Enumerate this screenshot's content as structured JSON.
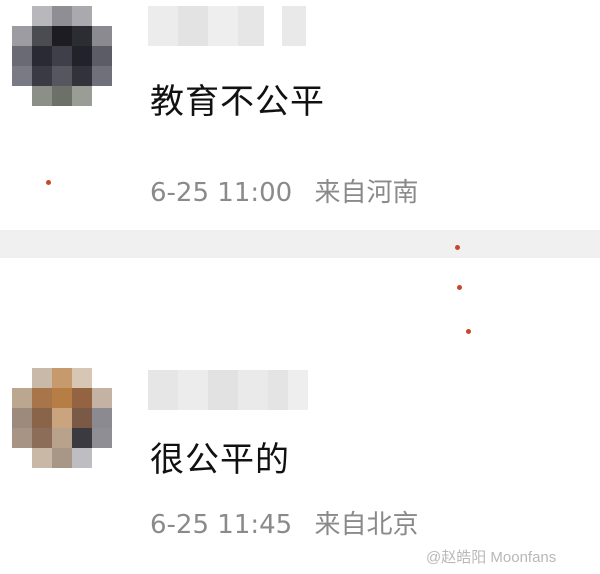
{
  "posts": [
    {
      "comment": "教育不公平",
      "date": "6-25",
      "time": "11:00",
      "source": "来自河南"
    },
    {
      "comment": "很公平的",
      "date": "6-25",
      "time": "11:45",
      "source": "来自北京"
    }
  ],
  "watermark": "@赵皓阳 Moonfans",
  "colors": {
    "text": "#111111",
    "meta": "#8a8a8a",
    "divider": "#f0f0f0",
    "dot": "#c8472a"
  }
}
